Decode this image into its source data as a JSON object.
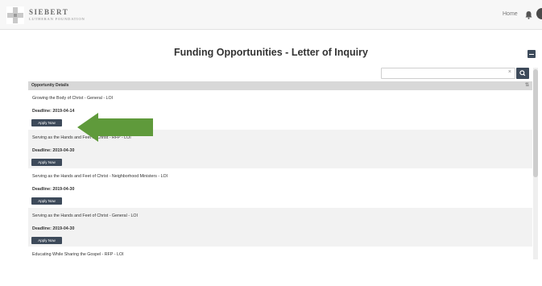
{
  "header": {
    "logo_name": "SIEBERT",
    "logo_sub": "LUTHERAN FOUNDATION",
    "home_label": "Home"
  },
  "page": {
    "title": "Funding Opportunities - Letter of Inquiry"
  },
  "search": {
    "value": "",
    "placeholder": "",
    "clear_label": "×"
  },
  "table": {
    "header": "Opportunity Details",
    "apply_label": "Apply Now",
    "rows": [
      {
        "title": "Growing the Body of Christ - General - LOI",
        "deadline": "Deadline: 2019-04-14"
      },
      {
        "title": "Serving as the Hands and Feet of Christ - RFP - LOI",
        "deadline": "Deadline: 2019-04-30"
      },
      {
        "title": "Serving as the Hands and Feet of Christ - Neighborhood Ministers - LOI",
        "deadline": "Deadline: 2019-04-30"
      },
      {
        "title": "Serving as the Hands and Feet of Christ - General - LOI",
        "deadline": "Deadline: 2019-04-30"
      },
      {
        "title": "Educating While Sharing the Gospel - RFP - LOI",
        "deadline": ""
      }
    ]
  },
  "colors": {
    "accent": "#3d4a5a",
    "arrow": "#5f9a3b",
    "header_row": "#d8d8d8"
  }
}
